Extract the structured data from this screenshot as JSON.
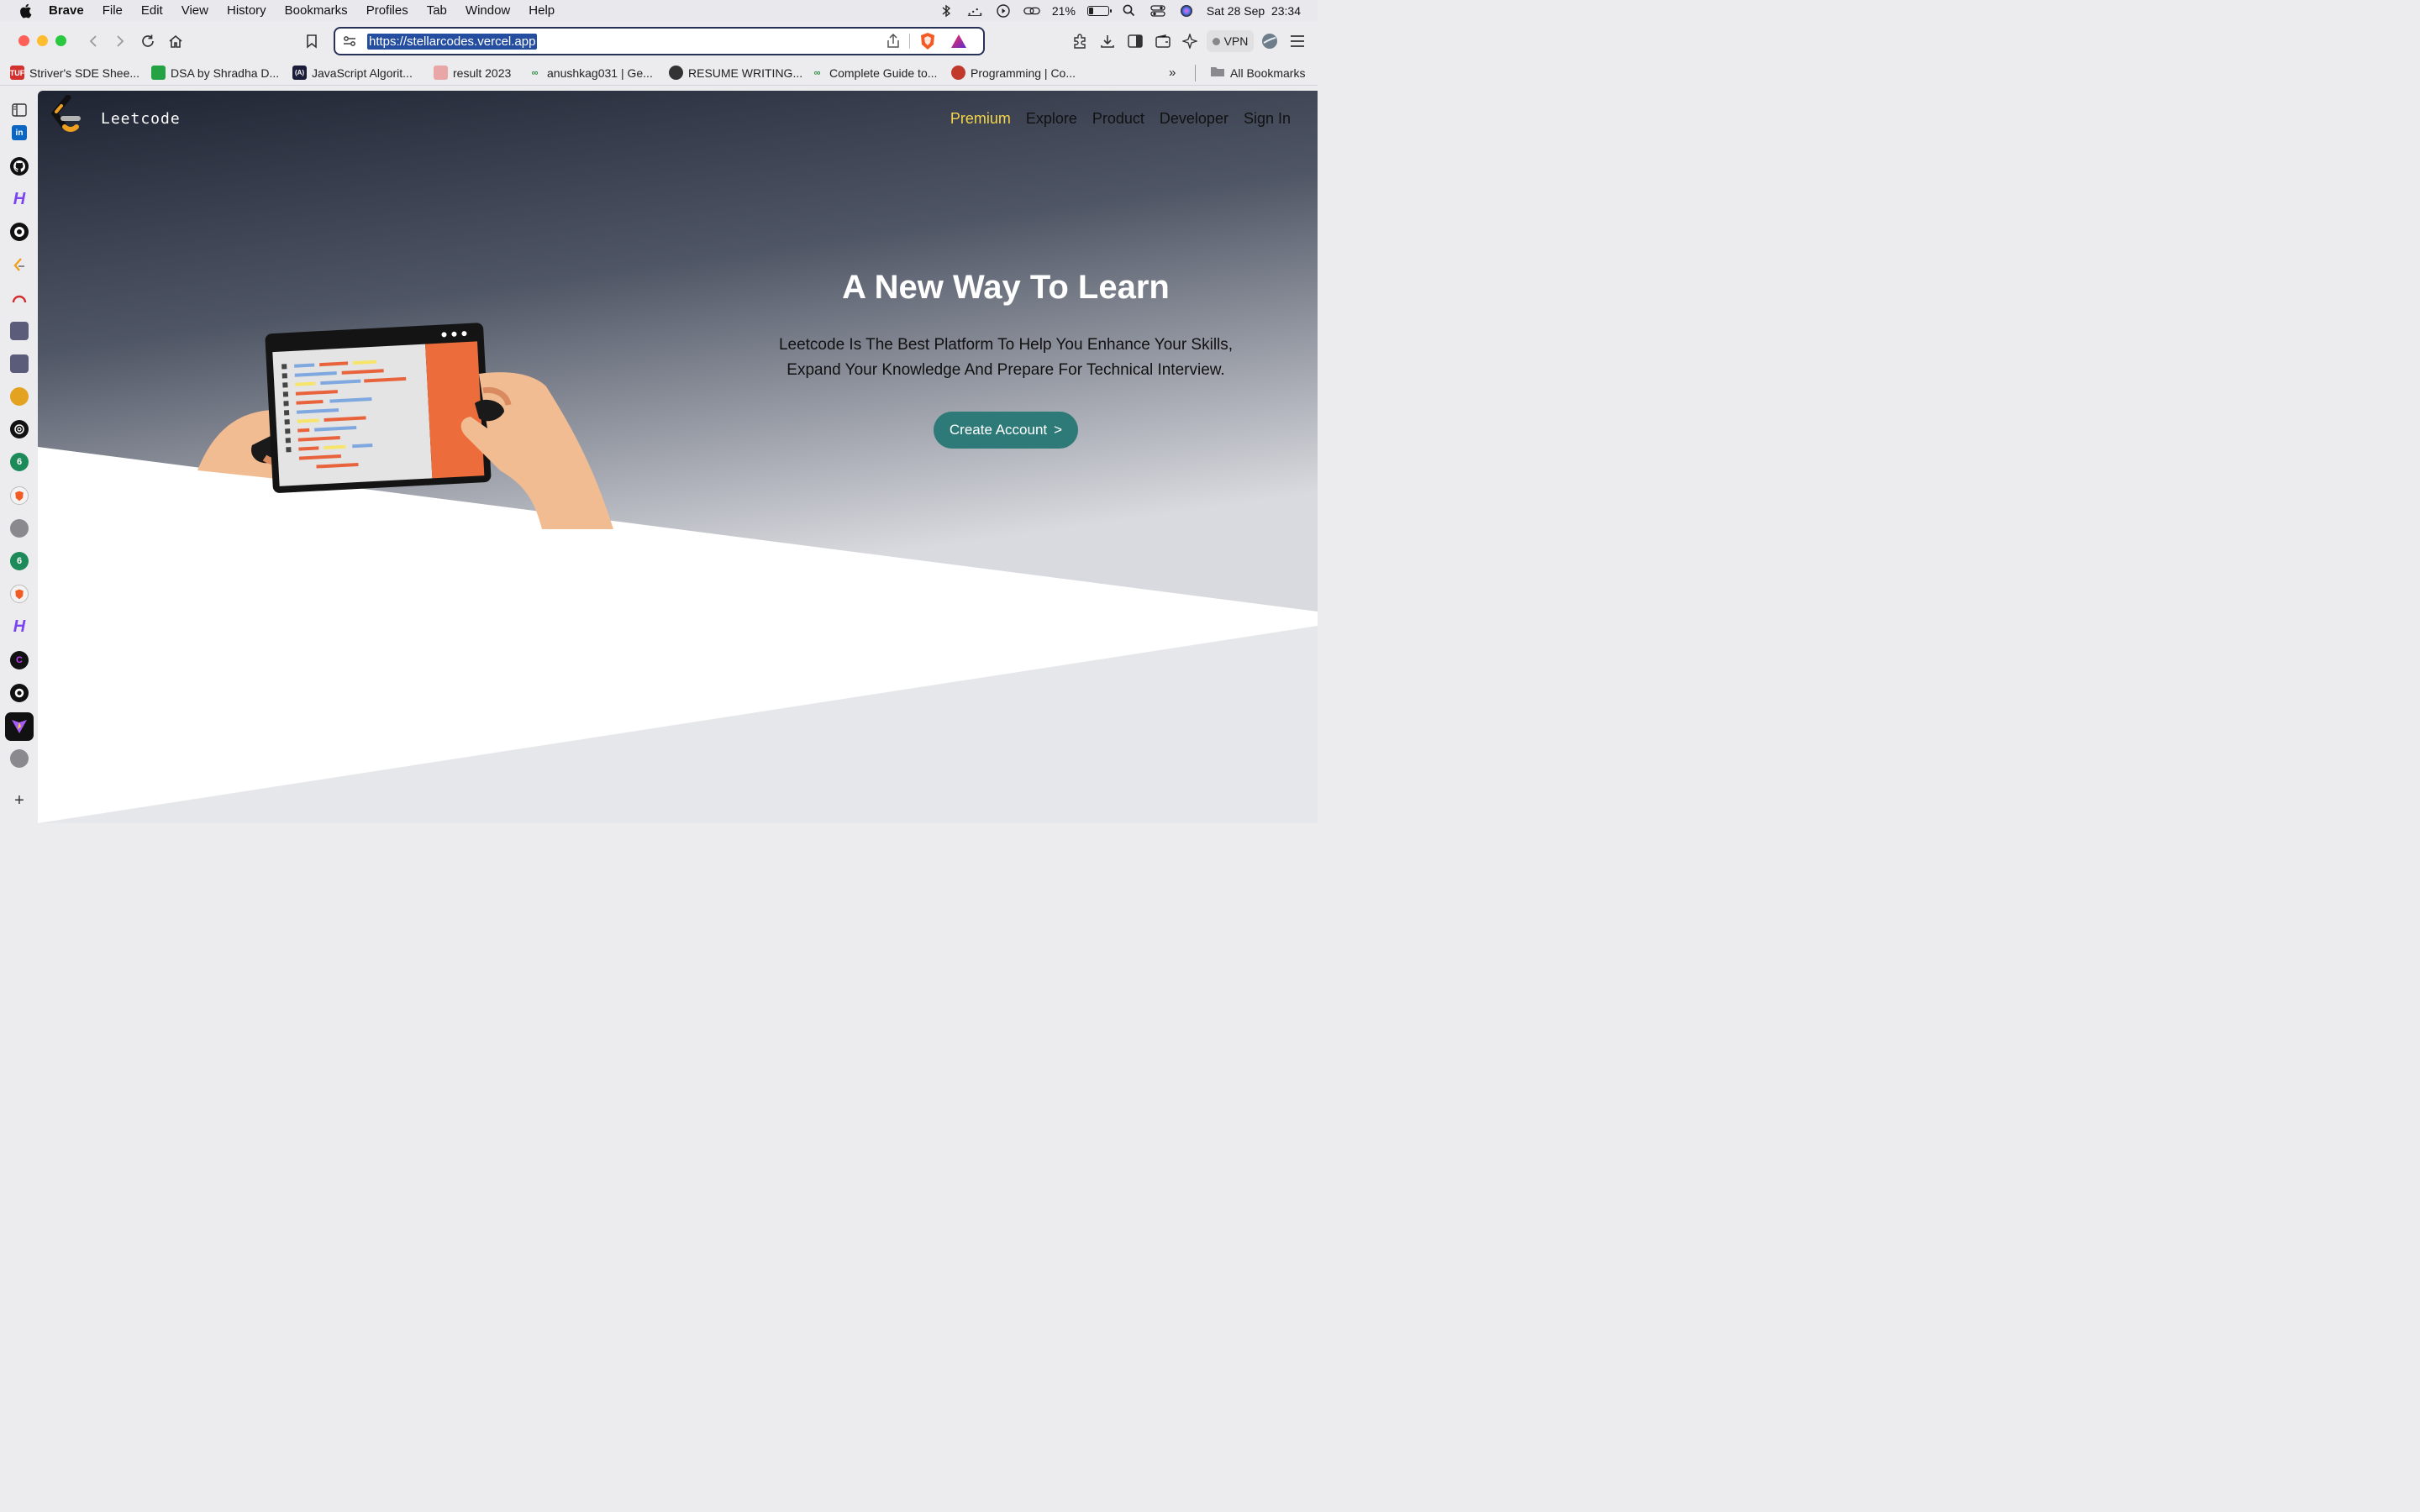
{
  "menubar": {
    "items": [
      "Brave",
      "File",
      "Edit",
      "View",
      "History",
      "Bookmarks",
      "Profiles",
      "Tab",
      "Window",
      "Help"
    ],
    "battery_percent": "21%",
    "battery_level": 0.21,
    "datetime": "Sat 28 Sep  23:34"
  },
  "toolbar": {
    "url": "https://stellarcodes.vercel.app",
    "vpn_label": "VPN"
  },
  "bookmarks": {
    "items": [
      {
        "label": "Striver's SDE Shee...",
        "icon_text": "TUF",
        "color": "#d3312f"
      },
      {
        "label": "DSA by Shradha D...",
        "icon_text": "",
        "color": "#25a244"
      },
      {
        "label": "JavaScript Algorit...",
        "icon_text": "(A)",
        "color": "#1b1b3a"
      },
      {
        "label": "result 2023",
        "icon_text": "",
        "color": "#e9a6a6"
      },
      {
        "label": "anushkag031 | Ge...",
        "icon_text": "",
        "color": "#2f8d46"
      },
      {
        "label": "RESUME WRITING...",
        "icon_text": "",
        "color": "#333"
      },
      {
        "label": "Complete Guide to...",
        "icon_text": "",
        "color": "#2f8d46"
      },
      {
        "label": "Programming | Co...",
        "icon_text": "",
        "color": "#c0392b"
      }
    ],
    "all_label": "All Bookmarks"
  },
  "page": {
    "brand": "Leetcode",
    "nav": [
      "Premium",
      "Explore",
      "Product",
      "Developer",
      "Sign In"
    ],
    "headline": "A New Way To Learn",
    "subtext_line1": "Leetcode Is The Best Platform To Help You Enhance Your Skills,",
    "subtext_line2": "Expand Your Knowledge And Prepare For Technical Interview.",
    "cta": "Create Account",
    "cta_chevron": ">"
  },
  "colors": {
    "accent": "#2e7a78",
    "premium": "#f5d54a",
    "hero_dark": "#1f2433",
    "tablet_orange": "#ec6d3b"
  }
}
